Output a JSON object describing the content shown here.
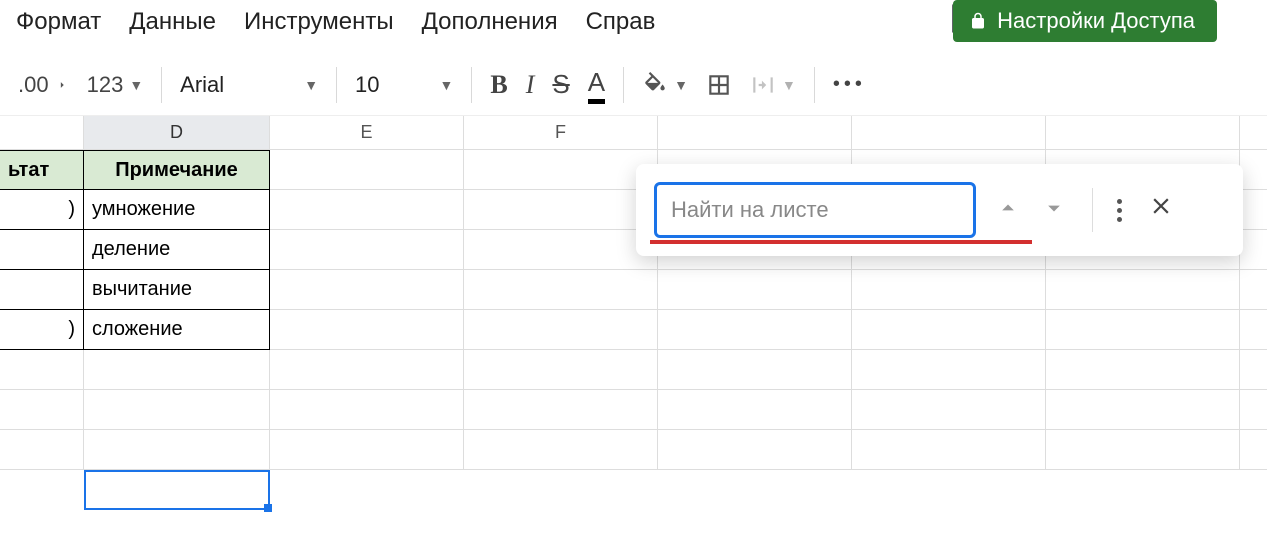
{
  "menu": {
    "format": "Формат",
    "data": "Данные",
    "tools": "Инструменты",
    "addons": "Дополнения",
    "help": "Справ"
  },
  "share": {
    "label": "Настройки Доступа"
  },
  "toolbar": {
    "decimals": ".00",
    "numfmt": "123",
    "font": "Arial",
    "size": "10",
    "bold": "B",
    "italic": "I",
    "strike": "S",
    "textcolor": "A",
    "more": "•••"
  },
  "columns": [
    "D",
    "E",
    "F"
  ],
  "table": {
    "header_c": "ьтат",
    "header_d": "Примечание",
    "rows": [
      {
        "c": ")",
        "d": "умножение"
      },
      {
        "c": "",
        "d": "деление"
      },
      {
        "c": "",
        "d": "вычитание"
      },
      {
        "c": ")",
        "d": "сложение"
      }
    ]
  },
  "find": {
    "placeholder": "Найти на листе"
  }
}
